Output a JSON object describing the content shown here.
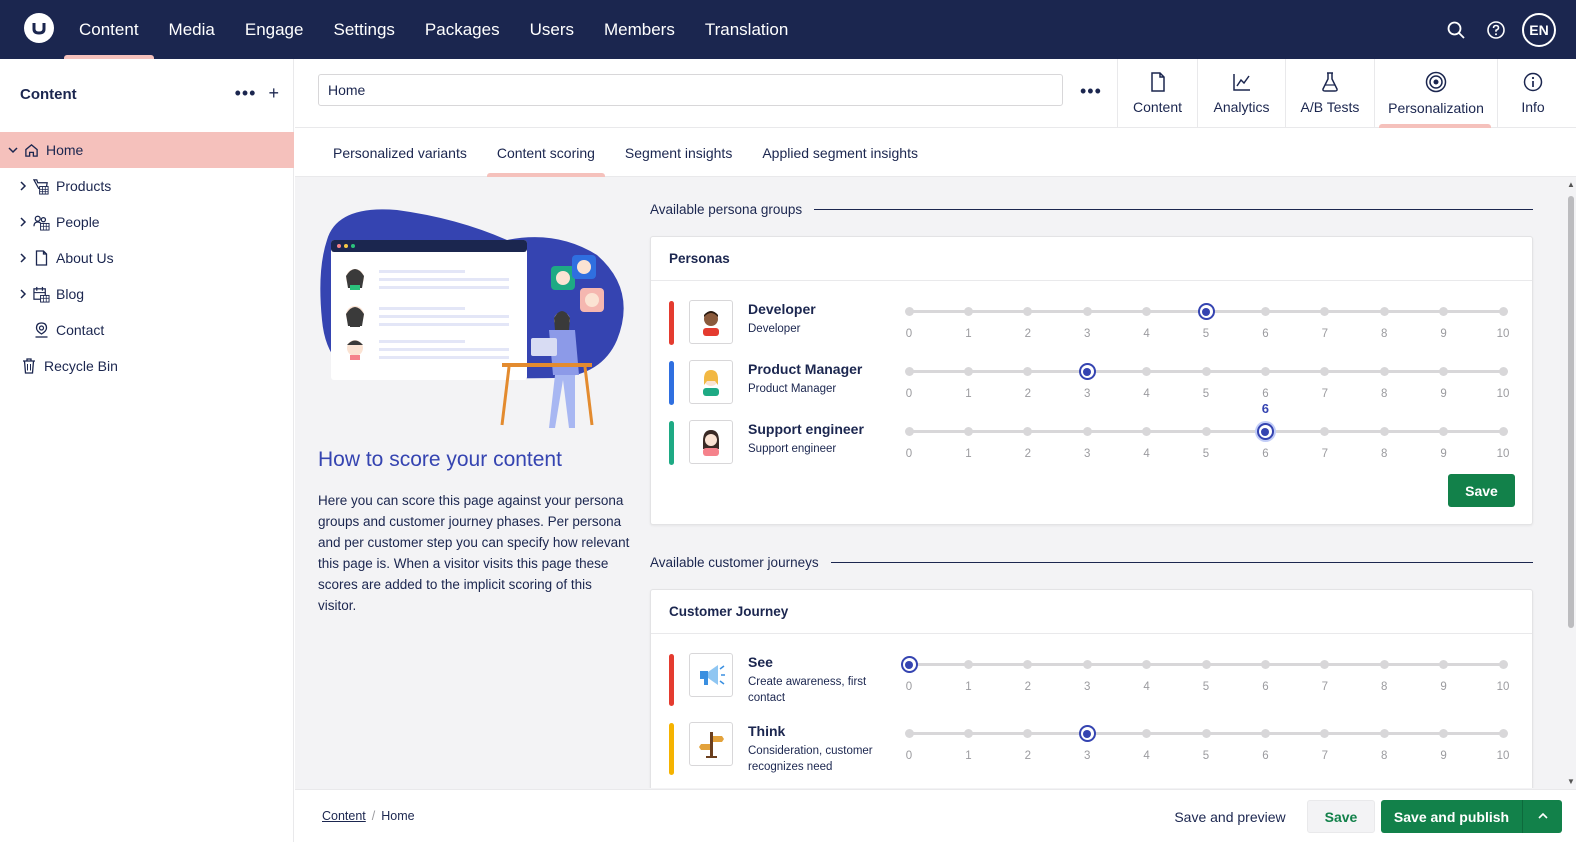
{
  "topbar": {
    "nav": [
      {
        "label": "Content",
        "active": true
      },
      {
        "label": "Media"
      },
      {
        "label": "Engage"
      },
      {
        "label": "Settings"
      },
      {
        "label": "Packages"
      },
      {
        "label": "Users"
      },
      {
        "label": "Members"
      },
      {
        "label": "Translation"
      }
    ],
    "user_initials": "EN"
  },
  "sidebar": {
    "title": "Content",
    "tree": [
      {
        "label": "Home",
        "icon": "home-icon",
        "selected": true
      },
      {
        "label": "Products",
        "icon": "cart-icon"
      },
      {
        "label": "People",
        "icon": "people-icon"
      },
      {
        "label": "About Us",
        "icon": "document-icon"
      },
      {
        "label": "Blog",
        "icon": "calendar-icon"
      },
      {
        "label": "Contact",
        "icon": "pin-icon"
      },
      {
        "label": "Recycle Bin",
        "icon": "trash-icon"
      }
    ]
  },
  "editor": {
    "node_name": "Home",
    "apps": [
      {
        "label": "Content",
        "icon": "document-icon"
      },
      {
        "label": "Analytics",
        "icon": "chart-line-icon"
      },
      {
        "label": "A/B Tests",
        "icon": "flask-icon"
      },
      {
        "label": "Personalization",
        "icon": "target-icon",
        "active": true
      },
      {
        "label": "Info",
        "icon": "info-icon"
      }
    ],
    "tabs": [
      {
        "label": "Personalized variants"
      },
      {
        "label": "Content scoring",
        "active": true
      },
      {
        "label": "Segment insights"
      },
      {
        "label": "Applied segment insights"
      }
    ]
  },
  "intro": {
    "title": "How to score your content",
    "text": "Here you can score this page against your persona groups and customer journey phases. Per persona and per customer step you can specify how relevant this page is. When a visitor visits this page these scores are added to the implicit scoring of this visitor."
  },
  "personas": {
    "section_title": "Available persona groups",
    "card_title": "Personas",
    "save_label": "Save",
    "scale": [
      "0",
      "1",
      "2",
      "3",
      "4",
      "5",
      "6",
      "7",
      "8",
      "9",
      "10"
    ],
    "rows": [
      {
        "name": "Developer",
        "description": "Developer",
        "color": "#e43b2f",
        "value": 5
      },
      {
        "name": "Product Manager",
        "description": "Product Manager",
        "color": "#2f6fe0",
        "value": 3
      },
      {
        "name": "Support engineer",
        "description": "Support engineer",
        "color": "#1eaa84",
        "value": 6,
        "tooltip": "6"
      }
    ]
  },
  "journeys": {
    "section_title": "Available customer journeys",
    "card_title": "Customer Journey",
    "rows": [
      {
        "name": "See",
        "description": "Create awareness, first contact",
        "color": "#e43b2f",
        "value": 0
      },
      {
        "name": "Think",
        "description": "Consideration, customer recognizes need",
        "color": "#f5b300",
        "value": 3
      }
    ]
  },
  "footer": {
    "breadcrumb": [
      "Content",
      "Home"
    ],
    "save_preview": "Save and preview",
    "save": "Save",
    "save_publish": "Save and publish"
  },
  "colors": {
    "topbar": "#1b264f",
    "accent_pink": "#f5c1bc",
    "accent_blue": "#3544b1",
    "success_green": "#12814a"
  }
}
